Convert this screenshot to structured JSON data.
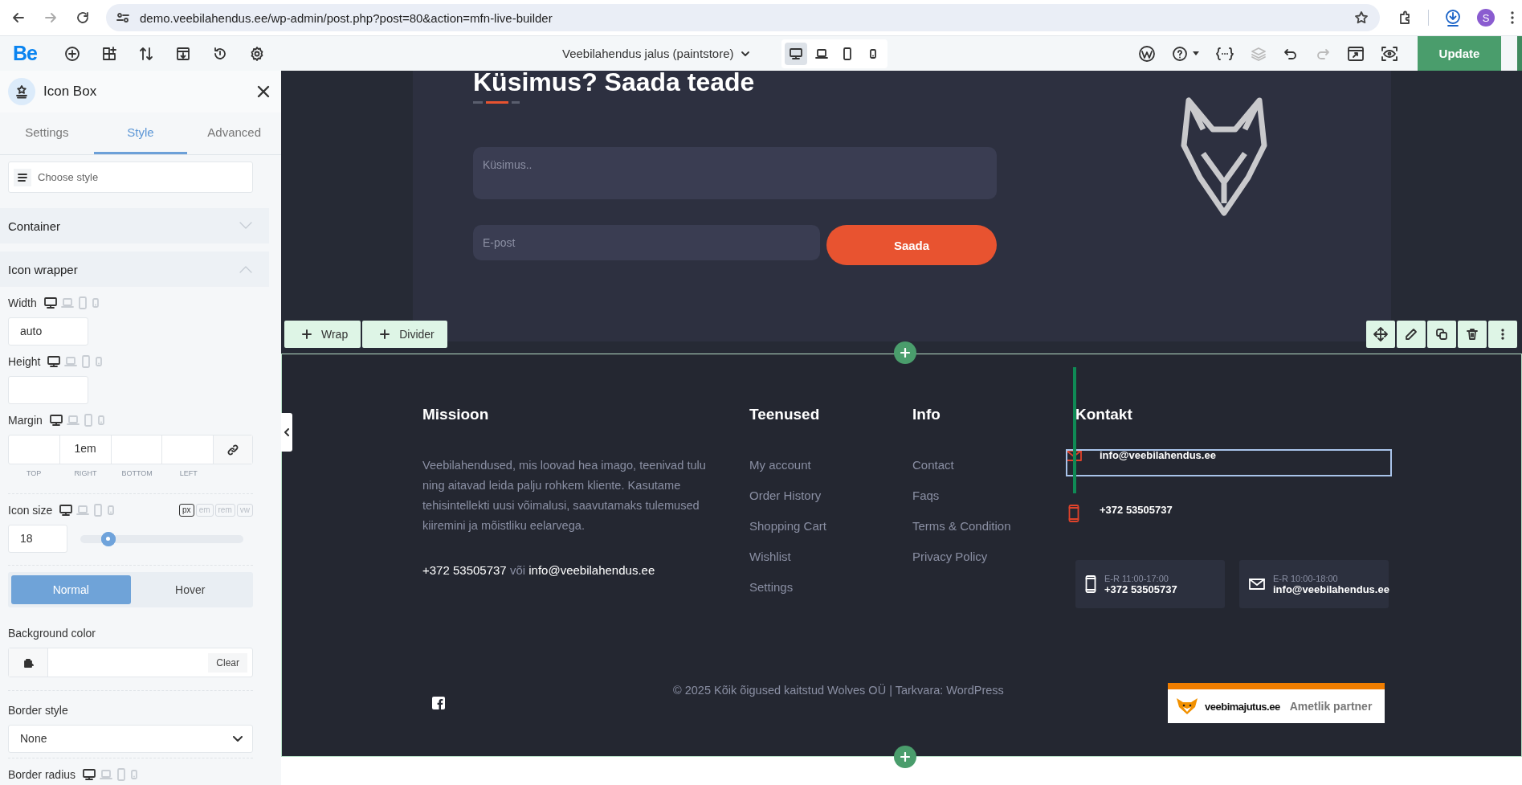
{
  "browser": {
    "url": "demo.veebilahendus.ee/wp-admin/post.php?post=80&action=mfn-live-builder",
    "avatar_letter": "S"
  },
  "toolbar": {
    "logo": "Be",
    "page_title": "Veebilahendus jalus (paintstore)",
    "devices": [
      {
        "kind": "desktop",
        "selected": true
      },
      {
        "kind": "laptop",
        "selected": false
      },
      {
        "kind": "tablet",
        "selected": false
      },
      {
        "kind": "mobile",
        "selected": false
      }
    ],
    "history": [
      {
        "kind": "undo",
        "disabled": false
      },
      {
        "kind": "redo",
        "disabled": true
      }
    ],
    "update_label": "Update"
  },
  "panel": {
    "title": "Icon Box",
    "tabs": [
      {
        "label": "Settings",
        "selected": false
      },
      {
        "label": "Style",
        "selected": true
      },
      {
        "label": "Advanced",
        "selected": false
      }
    ],
    "style_picker": {
      "placeholder": "Choose style"
    },
    "sections": [
      {
        "title": "Container",
        "expanded": false
      },
      {
        "title": "Icon wrapper",
        "expanded": true
      }
    ],
    "width": {
      "label": "Width",
      "value": "auto"
    },
    "height": {
      "label": "Height"
    },
    "margin": {
      "label": "Margin",
      "cells": [
        {
          "caption": "TOP"
        },
        {
          "caption": "RIGHT",
          "value": "1em"
        },
        {
          "caption": "BOTTOM"
        },
        {
          "caption": "LEFT"
        }
      ]
    },
    "icon_size": {
      "label": "Icon size",
      "value": "18",
      "level": 0.17,
      "units": [
        {
          "label": "px",
          "selected": true
        },
        {
          "label": "em",
          "selected": false
        },
        {
          "label": "rem",
          "selected": false
        },
        {
          "label": "vw",
          "selected": false
        }
      ]
    },
    "state_toggle": [
      {
        "label": "Normal",
        "selected": true
      },
      {
        "label": "Hover",
        "selected": false
      }
    ],
    "background_color": {
      "label": "Background color",
      "clear_label": "Clear"
    },
    "border_style": {
      "label": "Border style",
      "value": "None"
    },
    "border_radius": {
      "label": "Border radius"
    }
  },
  "form_section": {
    "heading": "Küsimus? Saada teade",
    "question_placeholder": "Küsimus..",
    "email_placeholder": "E-post",
    "submit_label": "Saada"
  },
  "section_tools": {
    "add_buttons": [
      {
        "label": "Wrap"
      },
      {
        "label": "Divider"
      }
    ]
  },
  "footer": {
    "mission": {
      "heading": "Missioon",
      "text": "Veebilahendused, mis loovad hea imago, teenivad tulu ning aitavad leida palju rohkem kliente. Kasutame tehisintellekti uusi võimalusi, saavutamaks tulemused kiiremini ja mõistliku eelarvega.",
      "phone": "+372 53505737",
      "separator": "või",
      "email": "info@veebilahendus.ee"
    },
    "services": {
      "heading": "Teenused",
      "links": [
        "My account",
        "Order History",
        "Shopping Cart",
        "Wishlist",
        "Settings"
      ]
    },
    "info": {
      "heading": "Info",
      "links": [
        "Contact",
        "Faqs",
        "Terms & Condition",
        "Privacy Policy"
      ]
    },
    "contact": {
      "heading": "Kontakt",
      "items": [
        {
          "kind": "email",
          "text": "info@veebilahendus.ee",
          "selected": true
        },
        {
          "kind": "phone",
          "text": "+372 53505737",
          "selected": false
        }
      ],
      "cards": [
        {
          "kind": "phone",
          "hours": "E-R 11:00-17:00",
          "value": "+372 53505737"
        },
        {
          "kind": "email",
          "hours": "E-R 10:00-18:00",
          "value": "info@veebilahendus.ee"
        }
      ]
    },
    "copyright": "© 2025 Kõik õigused kaitstud Wolves OÜ | Tarkvara: WordPress",
    "partner": {
      "brand": "veebimajutus.ee",
      "label": "Ametlik partner"
    }
  }
}
